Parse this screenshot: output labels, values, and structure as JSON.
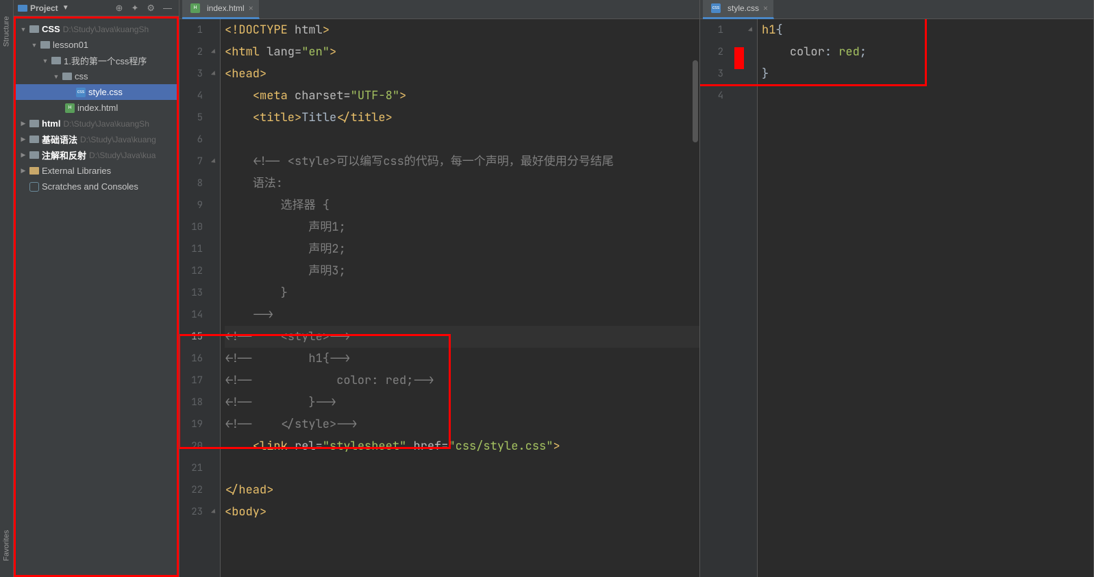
{
  "projectPanel": {
    "title": "Project",
    "tree": {
      "root": {
        "name": "CSS",
        "path": "D:\\Study\\Java\\kuangSh"
      },
      "lesson": "lesson01",
      "folder1": "1.我的第一个css程序",
      "folderCss": "css",
      "styleCss": "style.css",
      "indexHtml": "index.html",
      "htmlMod": {
        "name": "html",
        "path": "D:\\Study\\Java\\kuangSh"
      },
      "basicSyntax": {
        "name": "基础语法",
        "path": "D:\\Study\\Java\\kuang"
      },
      "annotation": {
        "name": "注解和反射",
        "path": "D:\\Study\\Java\\kua"
      },
      "extLibs": "External Libraries",
      "scratches": "Scratches and Consoles"
    }
  },
  "leftEditor": {
    "tab": "index.html",
    "lines": [
      {
        "n": 1,
        "html": "<span class='doctype'>&lt;!DOCTYPE </span><span class='attr-name'>html</span><span class='doctype'>&gt;</span>"
      },
      {
        "n": 2,
        "html": "<span class='tag'>&lt;html </span><span class='attr-name'>lang=</span><span class='attr-val'>\"en\"</span><span class='tag'>&gt;</span>"
      },
      {
        "n": 3,
        "html": "<span class='tag'>&lt;head&gt;</span>"
      },
      {
        "n": 4,
        "html": "    <span class='tag'>&lt;meta </span><span class='attr-name'>charset=</span><span class='attr-val'>\"UTF-8\"</span><span class='tag'>&gt;</span>"
      },
      {
        "n": 5,
        "html": "    <span class='tag'>&lt;title&gt;</span>Title<span class='tag'>&lt;/title&gt;</span>"
      },
      {
        "n": 6,
        "html": ""
      },
      {
        "n": 7,
        "html": "    <span class='comment'>&lt;!-- &lt;style&gt;可以编写css的代码，每一个声明，最好使用分号结尾</span>"
      },
      {
        "n": 8,
        "html": "    <span class='comment'>语法:</span>"
      },
      {
        "n": 9,
        "html": "        <span class='comment'>选择器 {</span>"
      },
      {
        "n": 10,
        "html": "            <span class='comment'>声明1;</span>"
      },
      {
        "n": 11,
        "html": "            <span class='comment'>声明2;</span>"
      },
      {
        "n": 12,
        "html": "            <span class='comment'>声明3;</span>"
      },
      {
        "n": 13,
        "html": "        <span class='comment'>}</span>"
      },
      {
        "n": 14,
        "html": "    <span class='comment'>--&gt;</span>"
      },
      {
        "n": 15,
        "html": "<span class='comment'>&lt;!--    &lt;style&gt;--&gt;</span>",
        "current": true
      },
      {
        "n": 16,
        "html": "<span class='comment'>&lt;!--        h1{--&gt;</span>"
      },
      {
        "n": 17,
        "html": "<span class='comment'>&lt;!--            color: red;--&gt;</span>"
      },
      {
        "n": 18,
        "html": "<span class='comment'>&lt;!--        }--&gt;</span>"
      },
      {
        "n": 19,
        "html": "<span class='comment'>&lt;!--    &lt;/style&gt;--&gt;</span>"
      },
      {
        "n": 20,
        "html": "    <span class='tag'>&lt;link </span><span class='attr-name'>rel=</span><span class='attr-val'>\"stylesheet\" </span><span class='attr-name'>href=</span><span class='attr-val'>\"css/style.css\"</span><span class='tag'>&gt;</span>"
      },
      {
        "n": 21,
        "html": ""
      },
      {
        "n": 22,
        "html": "<span class='tag'>&lt;/head&gt;</span>"
      },
      {
        "n": 23,
        "html": "<span class='tag'>&lt;body&gt;</span>"
      }
    ]
  },
  "rightEditor": {
    "tab": "style.css",
    "lines": [
      {
        "n": 1,
        "html": "<span class='css-sel'>h1</span><span class='punct'>{</span>"
      },
      {
        "n": 2,
        "html": "    <span class='css-prop'>color</span><span class='punct'>: </span><span class='css-val'>red</span><span class='punct'>;</span>",
        "swatch": true
      },
      {
        "n": 3,
        "html": "<span class='punct'>}</span>"
      },
      {
        "n": 4,
        "html": ""
      }
    ]
  },
  "sidebarVertical": {
    "structure": "Structure",
    "favorites": "Favorites"
  }
}
